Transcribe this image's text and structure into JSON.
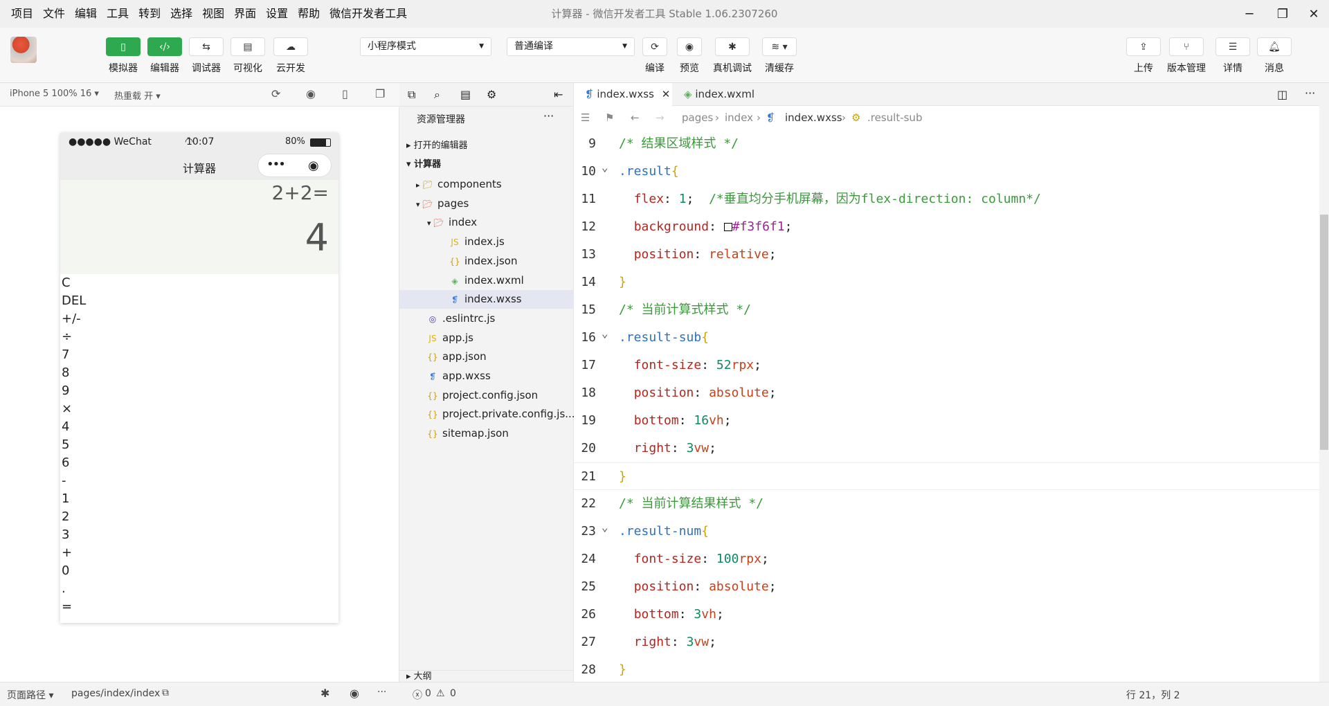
{
  "menubar": {
    "items": [
      "项目",
      "文件",
      "编辑",
      "工具",
      "转到",
      "选择",
      "视图",
      "界面",
      "设置",
      "帮助",
      "微信开发者工具"
    ],
    "title": "计算器 - 微信开发者工具 Stable 1.06.2307260"
  },
  "toolbar": {
    "simulator": "模拟器",
    "editor": "编辑器",
    "debugger": "调试器",
    "visual": "可视化",
    "cloud": "云开发",
    "mode_select": "小程序模式",
    "compile_select": "普通编译",
    "compile": "编译",
    "preview": "预览",
    "real_debug": "真机调试",
    "clear_cache": "清缓存",
    "upload": "上传",
    "version": "版本管理",
    "details": "详情",
    "messages": "消息"
  },
  "simulator": {
    "device": "iPhone 5 100% 16",
    "hot_reload": "热重载 开",
    "status": {
      "carrier": "●●●●● WeChat",
      "time": "10:07",
      "battery": "80%"
    },
    "nav_title": "计算器",
    "expression": "2+2=",
    "result": "4",
    "keys": [
      "C",
      "DEL",
      "+/-",
      "÷",
      "7",
      "8",
      "9",
      "×",
      "4",
      "5",
      "6",
      "-",
      "1",
      "2",
      "3",
      "+",
      "0",
      ".",
      "="
    ]
  },
  "explorer": {
    "title": "资源管理器",
    "open_editors": "打开的编辑器",
    "project": "计算器",
    "files": [
      {
        "name": "components",
        "indent": 1,
        "kind": "folder-collapsed"
      },
      {
        "name": "pages",
        "indent": 1,
        "kind": "folder-open"
      },
      {
        "name": "index",
        "indent": 2,
        "kind": "folder-open"
      },
      {
        "name": "index.js",
        "indent": 3,
        "kind": "js"
      },
      {
        "name": "index.json",
        "indent": 3,
        "kind": "json"
      },
      {
        "name": "index.wxml",
        "indent": 3,
        "kind": "wxml"
      },
      {
        "name": "index.wxss",
        "indent": 3,
        "kind": "wxss"
      },
      {
        "name": ".eslintrc.js",
        "indent": 1,
        "kind": "eslint"
      },
      {
        "name": "app.js",
        "indent": 1,
        "kind": "js"
      },
      {
        "name": "app.json",
        "indent": 1,
        "kind": "json"
      },
      {
        "name": "app.wxss",
        "indent": 1,
        "kind": "wxss"
      },
      {
        "name": "project.config.json",
        "indent": 1,
        "kind": "json"
      },
      {
        "name": "project.private.config.js...",
        "indent": 1,
        "kind": "json"
      },
      {
        "name": "sitemap.json",
        "indent": 1,
        "kind": "json"
      }
    ],
    "outline": "大纲"
  },
  "editor": {
    "tabs": [
      "index.wxss",
      "index.wxml"
    ],
    "breadcrumb": [
      "pages",
      "index",
      "index.wxss",
      ".result-sub"
    ],
    "lines": [
      {
        "n": "9",
        "html": "<span class='c-com'>/* 结果区域样式 */</span>"
      },
      {
        "n": "10",
        "html": "<span class='c-sel'>.result</span><span class='c-brace'>{</span>"
      },
      {
        "n": "11",
        "html": "  <span class='c-prop'>flex</span>: <span class='c-num'>1</span>;  <span class='c-com'>/*垂直均分手机屏幕，因为flex-direction: column*/</span>"
      },
      {
        "n": "12",
        "html": "  <span class='c-prop'>background</span>: <span style='display:inline-block;width:12px;height:12px;border:1px solid #000;background:#f3f6f1;vertical-align:middle'></span><span class='c-hex'>#f3f6f1</span>;"
      },
      {
        "n": "13",
        "html": "  <span class='c-prop'>position</span>: <span class='c-val'>relative</span>;"
      },
      {
        "n": "14",
        "html": "<span class='c-brace'>}</span>"
      },
      {
        "n": "15",
        "html": "<span class='c-com'>/* 当前计算式样式 */</span>"
      },
      {
        "n": "16",
        "html": "<span class='c-sel'>.result-sub</span><span class='c-brace'>{</span>"
      },
      {
        "n": "17",
        "html": "  <span class='c-prop'>font-size</span>: <span class='c-num'>52</span><span class='c-val'>rpx</span>;"
      },
      {
        "n": "18",
        "html": "  <span class='c-prop'>position</span>: <span class='c-val'>absolute</span>;"
      },
      {
        "n": "19",
        "html": "  <span class='c-prop'>bottom</span>: <span class='c-num'>16</span><span class='c-val'>vh</span>;"
      },
      {
        "n": "20",
        "html": "  <span class='c-prop'>right</span>: <span class='c-num'>3</span><span class='c-val'>vw</span>;"
      },
      {
        "n": "21",
        "html": "<span class='c-brace'>}</span>"
      },
      {
        "n": "22",
        "html": "<span class='c-com'>/* 当前计算结果样式 */</span>"
      },
      {
        "n": "23",
        "html": "<span class='c-sel'>.result-num</span><span class='c-brace'>{</span>"
      },
      {
        "n": "24",
        "html": "  <span class='c-prop'>font-size</span>: <span class='c-num'>100</span><span class='c-val'>rpx</span>;"
      },
      {
        "n": "25",
        "html": "  <span class='c-prop'>position</span>: <span class='c-val'>absolute</span>;"
      },
      {
        "n": "26",
        "html": "  <span class='c-prop'>bottom</span>: <span class='c-num'>3</span><span class='c-val'>vh</span>;"
      },
      {
        "n": "27",
        "html": "  <span class='c-prop'>right</span>: <span class='c-num'>3</span><span class='c-val'>vw</span>;"
      },
      {
        "n": "28",
        "html": "<span class='c-brace'>}</span>"
      }
    ]
  },
  "statusbar": {
    "page_path_label": "页面路径",
    "page_path": "pages/index/index",
    "errors": "0",
    "warnings": "0",
    "cursor": "行 21，列 2"
  },
  "colors": {
    "accent": "#2ea94f",
    "result_bg": "#f3f6f1"
  }
}
